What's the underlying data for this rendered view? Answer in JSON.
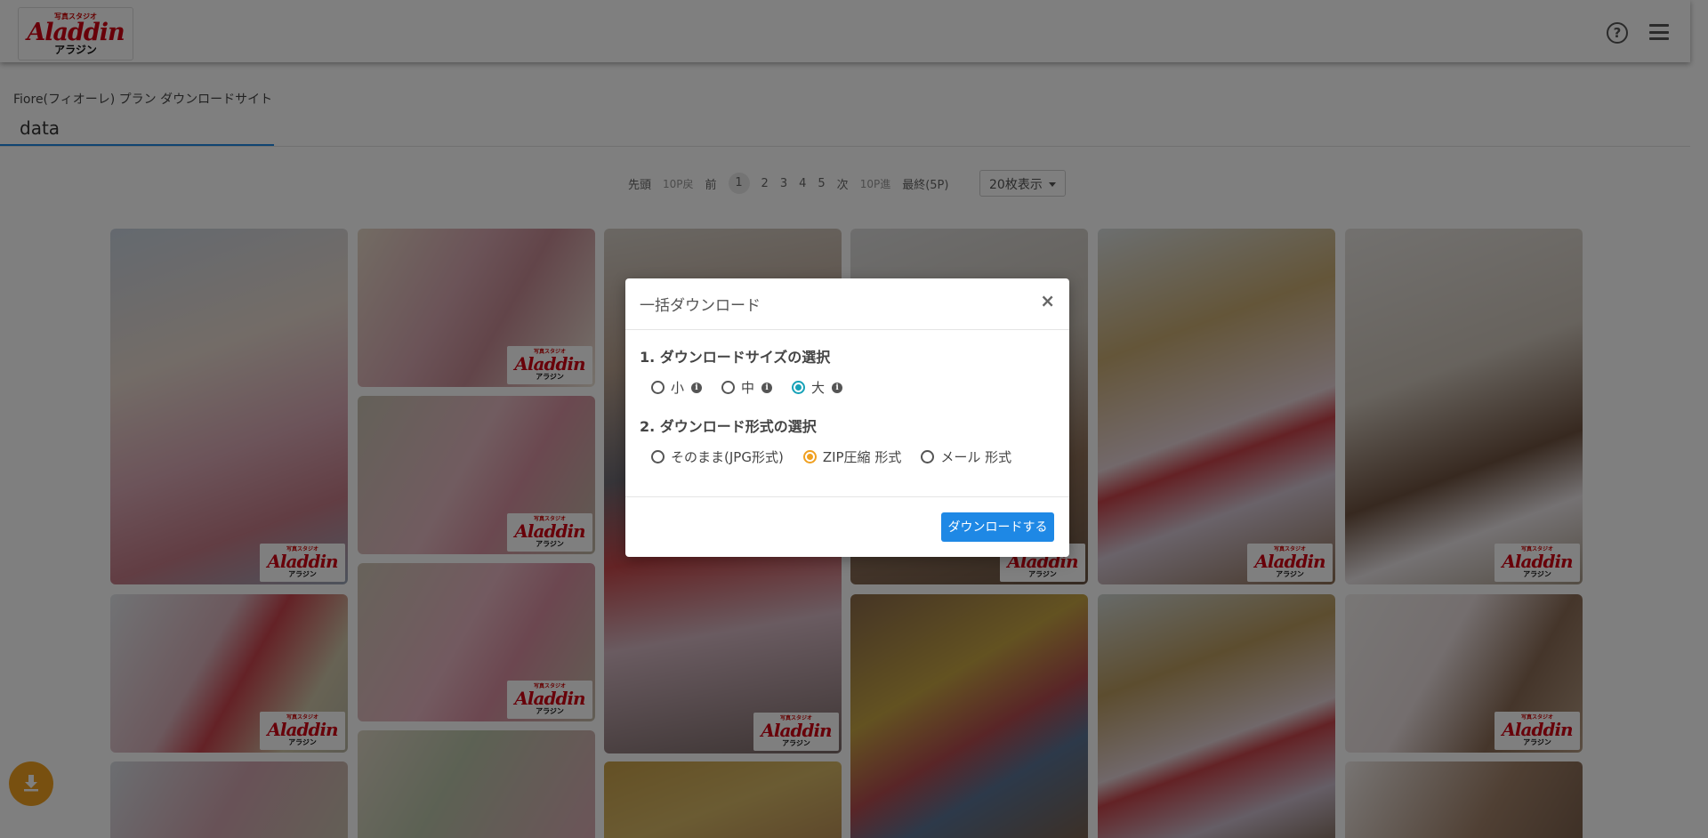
{
  "brand": {
    "logo_top": "写真スタジオ",
    "logo_main": "Aladdin",
    "logo_sub": "アラジン"
  },
  "header": {
    "help_icon": "question-circle-icon",
    "menu_icon": "hamburger-menu-icon"
  },
  "site_title": "Fiore(フィオーレ) プラン ダウンロードサイト",
  "folder_name": "data",
  "pagination": {
    "first": "先頭",
    "back10": "10P戻",
    "prev": "前",
    "pages": [
      "1",
      "2",
      "3",
      "4",
      "5"
    ],
    "current_page": "1",
    "next": "次",
    "forward10": "10P進",
    "last": "最終(5P)",
    "per_page": "20枚表示"
  },
  "fab": {
    "icon": "download-icon"
  },
  "modal": {
    "title": "一括ダウンロード",
    "close": "×",
    "section1": "1.  ダウンロードサイズの選択",
    "sizes": [
      {
        "label": "小",
        "checked": false
      },
      {
        "label": "中",
        "checked": false
      },
      {
        "label": "大",
        "checked": true
      }
    ],
    "section2": "2.  ダウンロード形式の選択",
    "formats": [
      {
        "label": "そのまま(JPG形式)",
        "checked": false
      },
      {
        "label": "ZIP圧縮 形式",
        "checked": true
      },
      {
        "label": "メール 形式",
        "checked": false
      }
    ],
    "submit": "ダウンロードする",
    "colors": {
      "size_selected": "#17a2b8",
      "format_selected": "#f0a020",
      "button": "#1e88e5"
    }
  }
}
